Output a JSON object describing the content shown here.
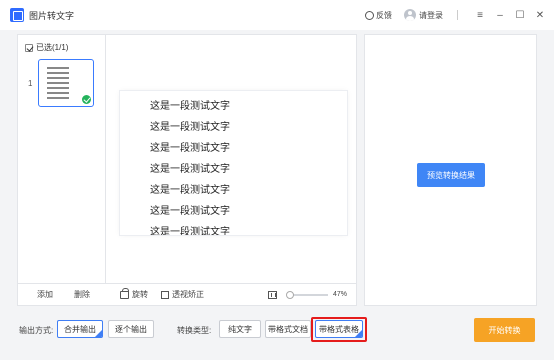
{
  "app": {
    "title": "图片转文字"
  },
  "header": {
    "feedback_label": "反馈",
    "login_label": "请登录"
  },
  "left_panel": {
    "selected_label": "已选(1/1)",
    "thumb_index": "1",
    "doc_lines": [
      "这是一段测试文字",
      "这是一段测试文字",
      "这是一段测试文字",
      "这是一段测试文字",
      "这是一段测试文字",
      "这是一段测试文字",
      "这是一段测试文字"
    ],
    "toolbar": {
      "add_label": "添加",
      "delete_label": "删除",
      "rotate_label": "旋转",
      "correct_label": "透视矫正",
      "zoom_label": "47%"
    }
  },
  "right_panel": {
    "preview_button": "预览转换结果"
  },
  "footer": {
    "output_label": "输出方式:",
    "output_options": [
      "合并输出",
      "逐个输出"
    ],
    "output_selected": "合并输出",
    "convert_label": "转换类型:",
    "convert_options": [
      "纯文字",
      "带格式文档",
      "带格式表格"
    ],
    "convert_selected": "带格式表格",
    "start_button": "开始转换"
  },
  "colors": {
    "accent_blue": "#3f86f6",
    "start_orange": "#f6a325",
    "highlight_red": "#e51c1c",
    "check_green": "#24b35c"
  }
}
